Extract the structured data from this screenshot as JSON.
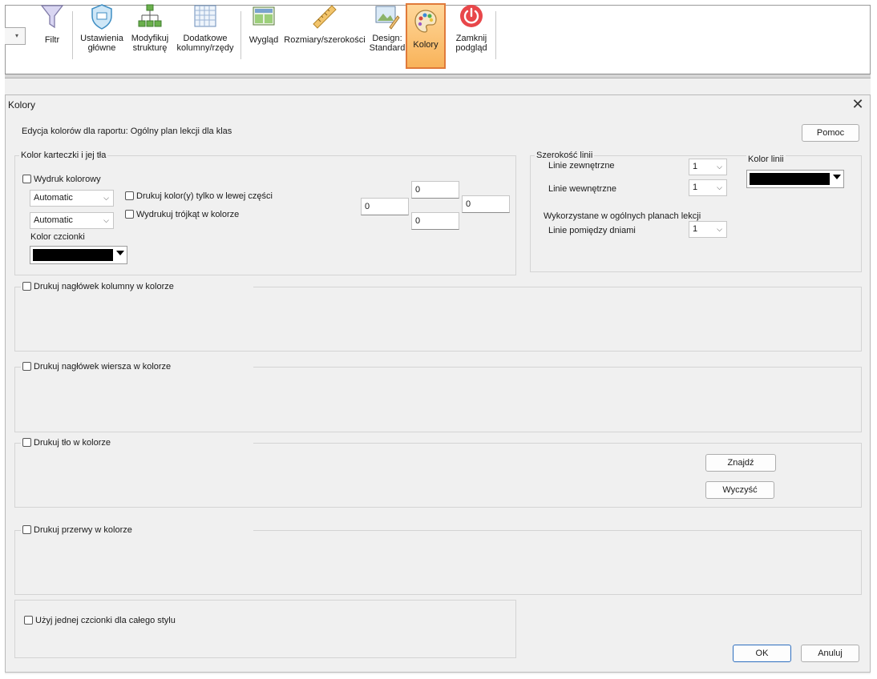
{
  "ribbon": {
    "filter": "Filtr",
    "main_settings": [
      "Ustawienia",
      "główne"
    ],
    "modify_structure": [
      "Modyfikuj",
      "strukturę"
    ],
    "extra_columns": [
      "Dodatkowe",
      "kolumny/rzędy"
    ],
    "look": "Wygląd",
    "sizes": "Rozmiary/szerokości",
    "design": [
      "Design:",
      "Standard"
    ],
    "colors": "Kolory",
    "close_preview": [
      "Zamknij",
      "podgląd"
    ]
  },
  "dialog": {
    "title": "Kolory",
    "description": "Edycja kolorów dla raportu: Ogólny plan lekcji dla klas",
    "help_button": "Pomoc",
    "card": {
      "group_label": "Kolor karteczki i jej tła",
      "color_print": "Wydruk kolorowy",
      "select1": "Automatic",
      "select2": "Automatic",
      "print_left_only": "Drukuj kolor(y) tylko w lewej części",
      "print_triangle": "Wydrukuj trójkąt w kolorze",
      "font_color_label": "Kolor czcionki",
      "font_color": "#000000",
      "margins": {
        "top": "0",
        "left": "0",
        "right": "0",
        "bottom": "0"
      }
    },
    "lines": {
      "group_label": "Szerokość linii",
      "outer_label": "Linie zewnętrzne",
      "outer_value": "1",
      "inner_label": "Linie wewnętrzne",
      "inner_value": "1",
      "used_label": "Wykorzystane w ogólnych planach lekcji",
      "between_days_label": "Linie pomiędzy dniami",
      "between_days_value": "1",
      "line_color_label": "Kolor linii",
      "line_color": "#000000"
    },
    "column_header": "Drukuj nagłówek kolumny w kolorze",
    "row_header": "Drukuj nagłówek wiersza w kolorze",
    "background": "Drukuj tło w kolorze",
    "find_button": "Znajdź",
    "clear_button": "Wyczyść",
    "breaks": "Drukuj przerwy w kolorze",
    "one_font": "Użyj jednej czcionki dla całego stylu",
    "ok_button": "OK",
    "cancel_button": "Anuluj"
  },
  "colors": {
    "accent_border": "#e07a3a",
    "primary_border": "#2e6fbf"
  }
}
